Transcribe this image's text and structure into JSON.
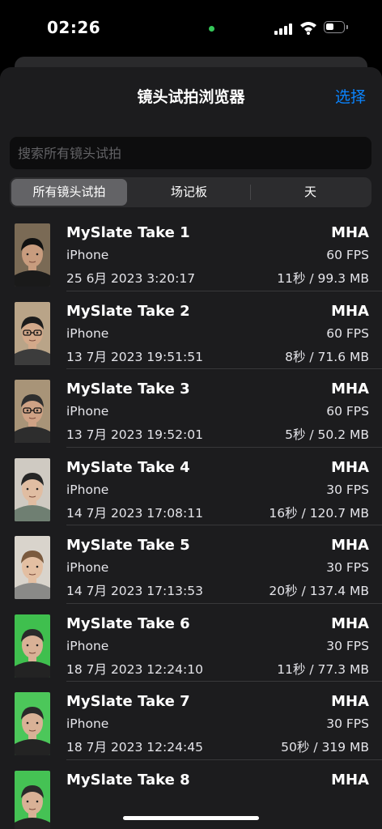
{
  "status": {
    "time": "02:26"
  },
  "header": {
    "title": "镜头试拍浏览器",
    "select_label": "选择"
  },
  "search": {
    "placeholder": "搜索所有镜头试拍"
  },
  "segments": [
    {
      "label": "所有镜头试拍",
      "selected": true
    },
    {
      "label": "场记板",
      "selected": false
    },
    {
      "label": "天",
      "selected": false
    }
  ],
  "takes": [
    {
      "name": "MySlate Take 1",
      "format": "MHA",
      "device": "iPhone",
      "fps": "60 FPS",
      "date": "25 6月 2023 3:20:17",
      "size": "11秒 / 99.3 MB",
      "bg": "#7a6a55",
      "shirt": "#1a1a1a",
      "hair": "#111111",
      "skin": "#c89c7e",
      "glasses": false
    },
    {
      "name": "MySlate Take 2",
      "format": "MHA",
      "device": "iPhone",
      "fps": "60 FPS",
      "date": "13 7月 2023 19:51:51",
      "size": "8秒 / 71.6 MB",
      "bg": "#b9a488",
      "shirt": "#3c3c3c",
      "hair": "#1c1c1c",
      "skin": "#d3a98a",
      "glasses": true
    },
    {
      "name": "MySlate Take 3",
      "format": "MHA",
      "device": "iPhone",
      "fps": "60 FPS",
      "date": "13 7月 2023 19:52:01",
      "size": "5秒 / 50.2 MB",
      "bg": "#a89478",
      "shirt": "#2d2d2d",
      "hair": "#2e2e2e",
      "skin": "#cfa285",
      "glasses": true
    },
    {
      "name": "MySlate Take 4",
      "format": "MHA",
      "device": "iPhone",
      "fps": "30 FPS",
      "date": "14 7月 2023 17:08:11",
      "size": "16秒 / 120.7 MB",
      "bg": "#cfcac2",
      "shirt": "#6f7f72",
      "hair": "#262626",
      "skin": "#e0bda2",
      "glasses": false
    },
    {
      "name": "MySlate Take 5",
      "format": "MHA",
      "device": "iPhone",
      "fps": "30 FPS",
      "date": "14 7月 2023 17:13:53",
      "size": "20秒 / 137.4 MB",
      "bg": "#d9d4cc",
      "shirt": "#8a8a88",
      "hair": "#7a5a3e",
      "skin": "#e3bfa2",
      "glasses": false
    },
    {
      "name": "MySlate Take 6",
      "format": "MHA",
      "device": "iPhone",
      "fps": "30 FPS",
      "date": "18 7月 2023 12:24:10",
      "size": "11秒 / 77.3 MB",
      "bg": "#3fbf4e",
      "shirt": "#232323",
      "hair": "#2a2a2a",
      "skin": "#d9b196",
      "glasses": false
    },
    {
      "name": "MySlate Take 7",
      "format": "MHA",
      "device": "iPhone",
      "fps": "30 FPS",
      "date": "18 7月 2023 12:24:45",
      "size": "50秒 / 319 MB",
      "bg": "#4cc75a",
      "shirt": "#232323",
      "hair": "#2a2a2a",
      "skin": "#d9b196",
      "glasses": false
    },
    {
      "name": "MySlate Take 8",
      "format": "MHA",
      "device": "",
      "fps": "",
      "date": "",
      "size": "",
      "bg": "#45c254",
      "shirt": "#232323",
      "hair": "#2a2a2a",
      "skin": "#d9b196",
      "glasses": false
    }
  ],
  "colors": {
    "accent": "#0a84ff",
    "sheet": "#1c1c1e",
    "background": "#000000"
  }
}
